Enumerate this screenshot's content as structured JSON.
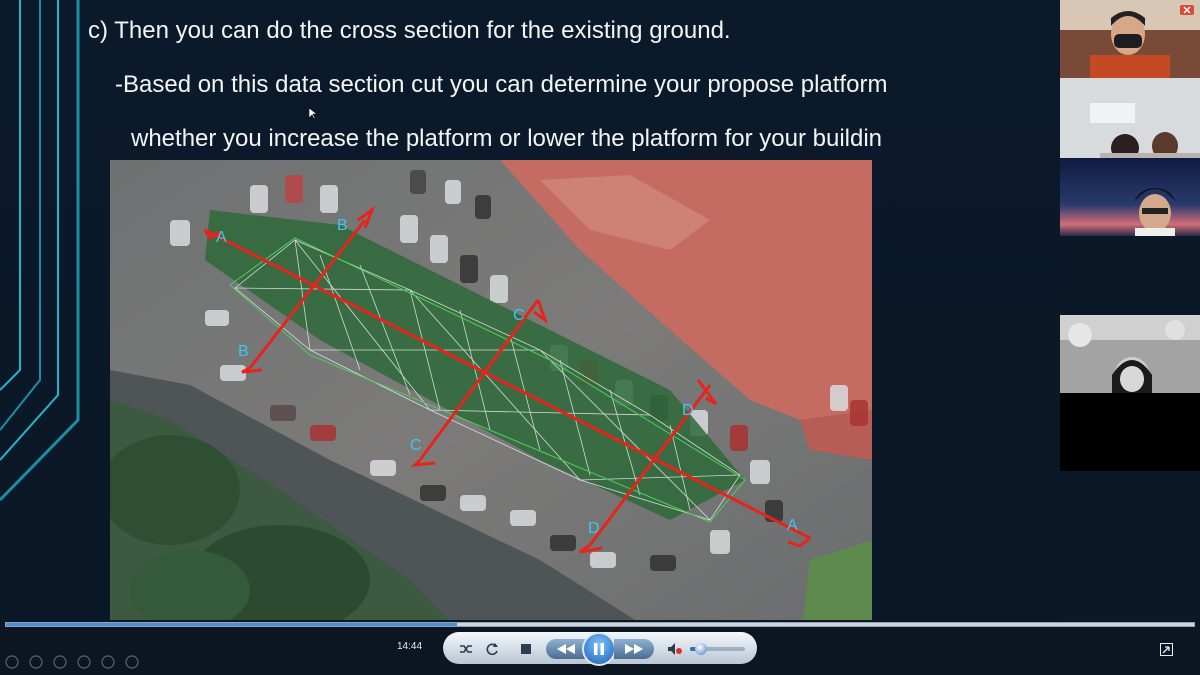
{
  "slide": {
    "heading": "c) Then you can do the cross section for the existing ground.",
    "bullet_line1": "-Based on this data section cut you can determine your propose platform",
    "bullet_line2": "whether you increase the platform or lower the platform  for your buildin"
  },
  "map": {
    "section_labels": {
      "a_start": "A",
      "a_end": "A",
      "b_start": "B",
      "b_end": "B",
      "c_start": "C",
      "c_end": "C",
      "d_start": "D",
      "d_end": "D"
    }
  },
  "player": {
    "current_time": "14:44",
    "progress_fraction": 0.38,
    "volume_fraction": 0.2
  },
  "icons": {
    "shuffle": "shuffle-icon",
    "repeat": "repeat-icon",
    "stop": "stop-icon",
    "rewind": "rewind-icon",
    "play_pause": "pause-icon",
    "fast_forward": "fast-forward-icon",
    "mute": "mute-icon",
    "switch_view": "switch-view-icon"
  },
  "colors": {
    "section_line": "#e8231b",
    "label": "#3ec6f0",
    "platform": "#2f6a3a"
  }
}
